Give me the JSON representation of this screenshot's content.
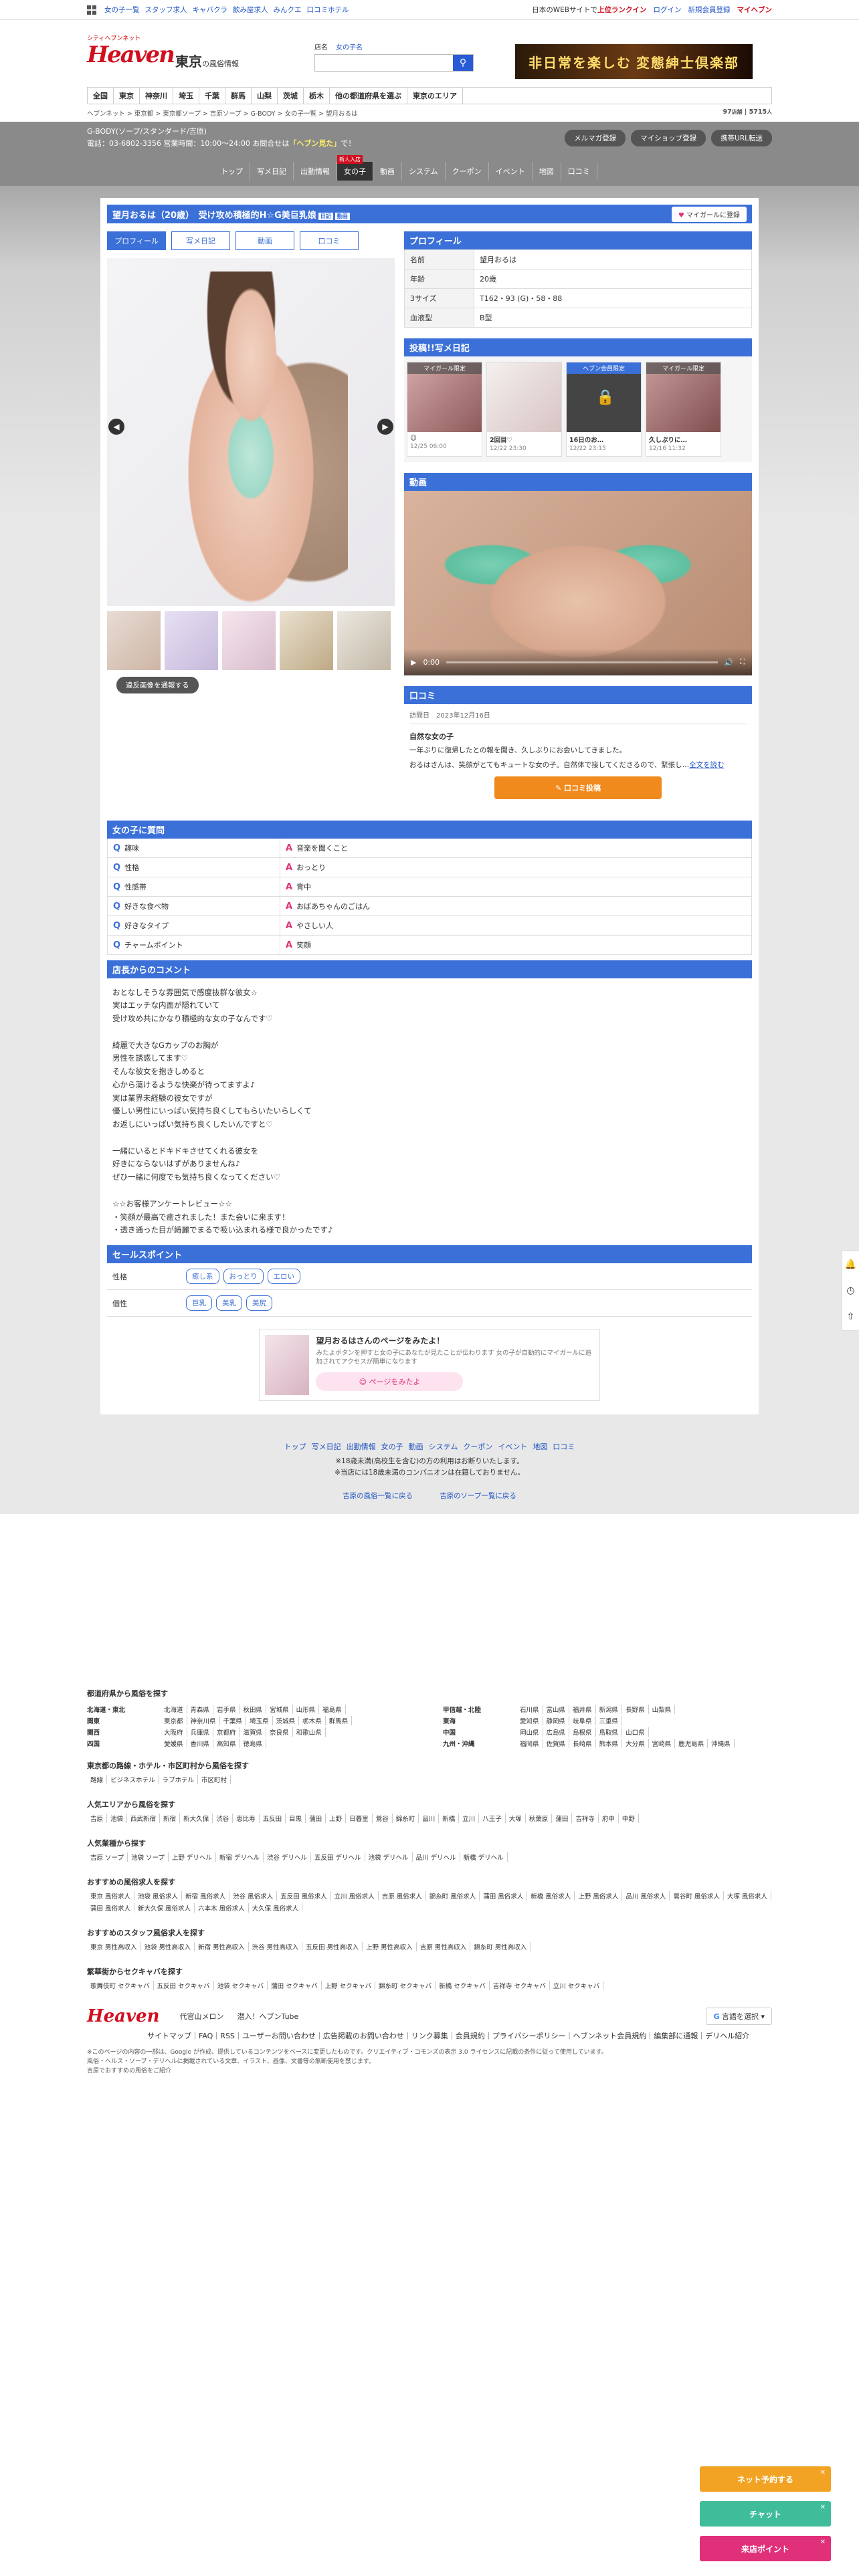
{
  "topbar": {
    "left": [
      "女の子一覧",
      "スタッフ求人",
      "キャバクラ",
      "飲み屋求人",
      "みんクエ",
      "口コミホテル"
    ],
    "right_text": "日本のWEBサイトで",
    "right_highlight": "上位ランクイン",
    "login": "ログイン",
    "register": "新規会員登録",
    "myheaven": "マイヘブン"
  },
  "header": {
    "logo_small": "シティヘブンネット",
    "logo": "Heaven",
    "region": "東京",
    "region_suffix": "の風俗情報",
    "search_tabs": [
      "店名",
      "女の子名"
    ],
    "search_placeholder": "",
    "banner": "非日常を楽しむ 変態紳士倶楽部"
  },
  "areanav": [
    "全国",
    "東京",
    "神奈川",
    "埼玉",
    "千葉",
    "群馬",
    "山梨",
    "茨城",
    "栃木",
    "他の都道府県を選ぶ",
    "東京のエリア"
  ],
  "breadcrumb": "ヘブンネット > 東京都 > 東京都ソープ > 吉原ソープ > G-BODY > 女の子一覧 > 望月おるは",
  "counts": {
    "shops": "97",
    "shops_unit": "店舗",
    "girls": "5715",
    "girls_unit": "人"
  },
  "shop": {
    "name": "G-BODY(ソープ/スタンダード/吉原)",
    "tel_label": "電話：03-6802-3356 営業時間：10:00～24:00 お問合せは",
    "tel_highlight": "「ヘブン見た」",
    "tel_suffix": "で！",
    "buttons": [
      "メルマガ登録",
      "マイショップ登録",
      "携帯URL転送"
    ],
    "nav": [
      "トップ",
      "写メ日記",
      "出勤情報",
      "女の子",
      "動画",
      "システム",
      "クーポン",
      "イベント",
      "地図",
      "口コミ"
    ],
    "nav_badge": "新人入店"
  },
  "girl": {
    "title": "望月おるは（20歳）　受け攻め積極的H☆G美巨乳娘",
    "badges": [
      "日記",
      "動画"
    ],
    "mygirl": "マイガールに登録",
    "tabs": [
      "プロフィール",
      "写メ日記",
      "動画",
      "口コミ"
    ],
    "report": "違反画像を通報する"
  },
  "profile": {
    "heading": "プロフィール",
    "rows": [
      {
        "k": "名前",
        "v": "望月おるは"
      },
      {
        "k": "年齢",
        "v": "20歳"
      },
      {
        "k": "3サイズ",
        "v": "T162・93 (G)・58・88"
      },
      {
        "k": "血液型",
        "v": "B型"
      }
    ]
  },
  "diary": {
    "heading": "投稿!!写メ日記",
    "items": [
      {
        "tag": "マイガール限定",
        "title": "☺︎",
        "date": "12/25 06:00"
      },
      {
        "tag": "",
        "title": "2回目♡",
        "date": "12/22 23:30"
      },
      {
        "tag": "ヘブン会員限定",
        "title": "16日のお…",
        "date": "12/22 23:15"
      },
      {
        "tag": "マイガール限定",
        "title": "久しぶりに…",
        "date": "12/16 11:32"
      }
    ]
  },
  "video": {
    "heading": "動画",
    "time": "0:00"
  },
  "kuchikomi": {
    "heading": "口コミ",
    "date_label": "訪問日",
    "date": "2023年12月16日",
    "title": "自然な女の子",
    "body1": "一年ぶりに復帰したとの報を聞き、久しぶりにお会いしてきました。",
    "body2": "おるはさんは、笑顔がとてもキュートな女の子。自然体で接してくださるので、緊張し…",
    "more": "全文を読む",
    "button": "口コミ投稿"
  },
  "qa": {
    "heading": "女の子に質問",
    "rows": [
      {
        "q": "趣味",
        "a": "音楽を聞くこと"
      },
      {
        "q": "性格",
        "a": "おっとり"
      },
      {
        "q": "性感帯",
        "a": "背中"
      },
      {
        "q": "好きな食べ物",
        "a": "おばあちゃんのごはん"
      },
      {
        "q": "好きなタイプ",
        "a": "やさしい人"
      },
      {
        "q": "チャームポイント",
        "a": "笑顔"
      }
    ]
  },
  "comment": {
    "heading": "店長からのコメント",
    "text": "おとなしそうな雰囲気で感度抜群な彼女☆\n実はエッチな内面が隠れていて\n受け攻め共にかなり積極的な女の子なんです♡\n\n綺麗で大きなGカップのお胸が\n男性を誘惑してます♡\nそんな彼女を抱きしめると\n心から蕩けるような快楽が待ってますよ♪\n実は業界未経験の彼女ですが\n優しい男性にいっぱい気持ち良くしてもらいたいらしくて\nお返しにいっぱい気持ち良くしたいんですと♡\n\n一緒にいるとドキドキさせてくれる彼女を\n好きにならないはずがありませんね♪\nぜひ一緒に何度でも気持ち良くなってください♡\n\n☆☆お客様アンケートレビュー☆☆\n・笑顔が最高で癒されました！また会いに来ます！\n・透き通った目が綺麗でまるで吸い込まれる様で良かったです♪"
  },
  "sales": {
    "heading": "セールスポイント",
    "rows": [
      {
        "k": "性格",
        "tags": [
          "癒し系",
          "おっとり",
          "エロい"
        ]
      },
      {
        "k": "個性",
        "tags": [
          "巨乳",
          "美乳",
          "美尻"
        ]
      }
    ]
  },
  "promo": {
    "title": "望月おるはさんのページをみたよ！",
    "desc": "みたよボタンを押すと女の子にあなたが見たことが伝わります 女の子が自動的にマイガールに追加されてアクセスが簡単になります",
    "button": "ページをみたよ"
  },
  "bottomnav": [
    "トップ",
    "写メ日記",
    "出勤情報",
    "女の子",
    "動画",
    "システム",
    "クーポン",
    "イベント",
    "地図",
    "口コミ"
  ],
  "notices": [
    "※18歳未満(高校生を含む)の方の利用はお断りいたします。",
    "※当店には18歳未満のコンパニオンは在籍しておりません。"
  ],
  "backlinks": [
    "吉原の風俗一覧に戻る",
    "吉原のソープ一覧に戻る"
  ],
  "footer": {
    "pref_heading": "都道府県から風俗を探す",
    "regions_left": [
      {
        "r": "北海道・東北",
        "c": [
          "北海道",
          "青森県",
          "岩手県",
          "秋田県",
          "宮城県",
          "山形県",
          "福島県"
        ]
      },
      {
        "r": "関東",
        "c": [
          "東京都",
          "神奈川県",
          "千葉県",
          "埼玉県",
          "茨城県",
          "栃木県",
          "群馬県"
        ]
      },
      {
        "r": "関西",
        "c": [
          "大阪府",
          "兵庫県",
          "京都府",
          "滋賀県",
          "奈良県",
          "和歌山県"
        ]
      },
      {
        "r": "四国",
        "c": [
          "愛媛県",
          "香川県",
          "高知県",
          "徳島県"
        ]
      }
    ],
    "regions_right": [
      {
        "r": "甲信越・北陸",
        "c": [
          "石川県",
          "富山県",
          "福井県",
          "新潟県",
          "長野県",
          "山梨県"
        ]
      },
      {
        "r": "東海",
        "c": [
          "愛知県",
          "静岡県",
          "岐阜県",
          "三重県"
        ]
      },
      {
        "r": "中国",
        "c": [
          "岡山県",
          "広島県",
          "島根県",
          "鳥取県",
          "山口県"
        ]
      },
      {
        "r": "九州・沖縄",
        "c": [
          "福岡県",
          "佐賀県",
          "長崎県",
          "熊本県",
          "大分県",
          "宮崎県",
          "鹿児島県",
          "沖縄県"
        ]
      }
    ],
    "station_heading": "東京都の路線・ホテル・市区町村から風俗を探す",
    "station_links": [
      "路線",
      "ビジネスホテル",
      "ラブホテル",
      "市区町村"
    ],
    "area_heading": "人気エリアから風俗を探す",
    "area_links": [
      "吉原",
      "池袋",
      "西武新宿",
      "新宿",
      "新大久保",
      "渋谷",
      "恵比寿",
      "五反田",
      "目黒",
      "蒲田",
      "上野",
      "日暮里",
      "鶯谷",
      "錦糸町",
      "品川",
      "新橋",
      "立川",
      "八王子",
      "大塚",
      "秋葉原",
      "蒲田",
      "吉祥寺",
      "府中",
      "中野"
    ],
    "genre_heading": "人気業種から探す",
    "genre_links": [
      "吉原 ソープ",
      "池袋 ソープ",
      "上野 デリヘル",
      "新宿 デリヘル",
      "渋谷 デリヘル",
      "五反田 デリヘル",
      "池袋 デリヘル",
      "品川 デリヘル",
      "新橋 デリヘル"
    ],
    "job_heading": "おすすめの風俗求人を探す",
    "job_links": [
      "東京 風俗求人",
      "池袋 風俗求人",
      "新宿 風俗求人",
      "渋谷 風俗求人",
      "五反田 風俗求人",
      "立川 風俗求人",
      "吉原 風俗求人",
      "錦糸町 風俗求人",
      "蒲田 風俗求人",
      "新橋 風俗求人",
      "上野 風俗求人",
      "品川 風俗求人",
      "鶯谷町 風俗求人",
      "大塚 風俗求人",
      "蒲田 風俗求人",
      "新大久保 風俗求人",
      "六本木 風俗求人",
      "大久保 風俗求人"
    ],
    "staff_heading": "おすすめのスタッフ風俗求人を探す",
    "staff_links": [
      "東京 男性高収入",
      "池袋 男性高収入",
      "新宿 男性高収入",
      "渋谷 男性高収入",
      "五反田 男性高収入",
      "上野 男性高収入",
      "吉原 男性高収入",
      "錦糸町 男性高収入"
    ],
    "seku_heading": "繁華街からセクキャバを探す",
    "seku_links": [
      "歌舞伎町 セクキャバ",
      "五反田 セクキャバ",
      "池袋 セクキャバ",
      "蒲田 セクキャバ",
      "上野 セクキャバ",
      "錦糸町 セクキャバ",
      "新橋 セクキャバ",
      "吉祥寺 セクキャバ",
      "立川 セクキャバ"
    ],
    "logo": "Heaven",
    "sub1": "代官山メロン",
    "sub2": "潜入！ヘブンTube",
    "lang": "言語を選択",
    "links": "サイトマップ｜FAQ｜RSS｜ユーザーお問い合わせ｜広告掲載のお問い合わせ｜リンク募集｜会員規約｜プライバシーポリシー｜ヘブンネット会員規約｜編集部に通報｜デリヘル紹介",
    "copy1": "※このページの内容の一部は、Google が作成、提供しているコンテンツをベースに変更したものです。クリエイティブ・コモンズの表示 3.0 ライセンスに記載の条件に従って使用しています。",
    "copy2": "風俗・ヘルス・ソープ・デリヘルに掲載されている文章、イラスト、画像、文書等の無断使用を禁じます。",
    "copy3": "吉原でおすすめの風俗をご紹介"
  },
  "float": [
    "ネット予約する",
    "チャット",
    "来店ポイント"
  ]
}
